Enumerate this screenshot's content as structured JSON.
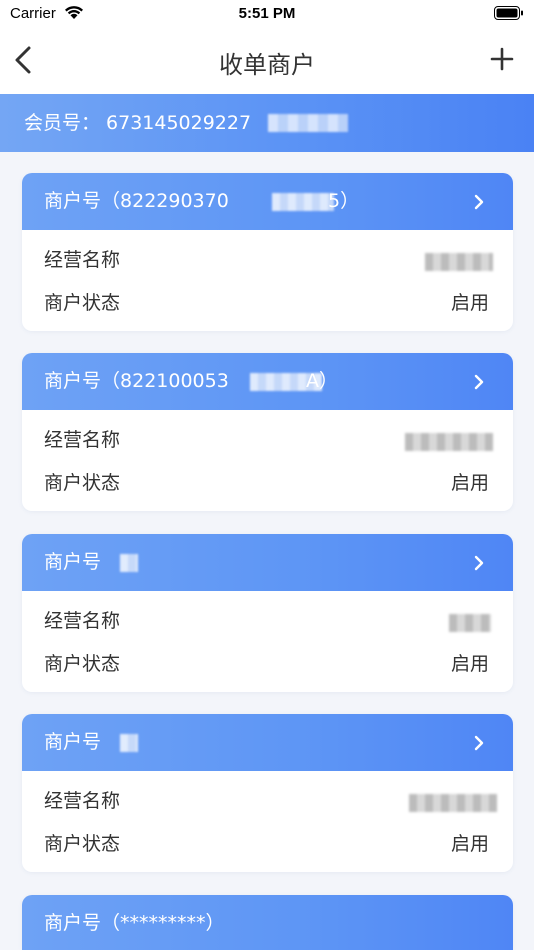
{
  "status_bar": {
    "carrier": "Carrier",
    "time": "5:51 PM"
  },
  "nav": {
    "title": "收单商户"
  },
  "member": {
    "label": "会员号：",
    "value": "673145029227"
  },
  "cards": [
    {
      "header_label": "商户号",
      "header_value": "（822290370",
      "header_tail": "5）",
      "name_label": "经营名称",
      "status_label": "商户状态",
      "status_value": "启用"
    },
    {
      "header_label": "商户号",
      "header_value": "（822100053",
      "header_tail": "A）",
      "name_label": "经营名称",
      "status_label": "商户状态",
      "status_value": "启用"
    },
    {
      "header_label": "商户号",
      "header_value": "",
      "header_tail": "",
      "name_label": "经营名称",
      "status_label": "商户状态",
      "status_value": "启用"
    },
    {
      "header_label": "商户号",
      "header_value": "",
      "header_tail": "",
      "name_label": "经营名称",
      "status_label": "商户状态",
      "status_value": "启用"
    },
    {
      "header_label": "商户号",
      "header_value": "（*********）",
      "header_tail": ""
    }
  ]
}
